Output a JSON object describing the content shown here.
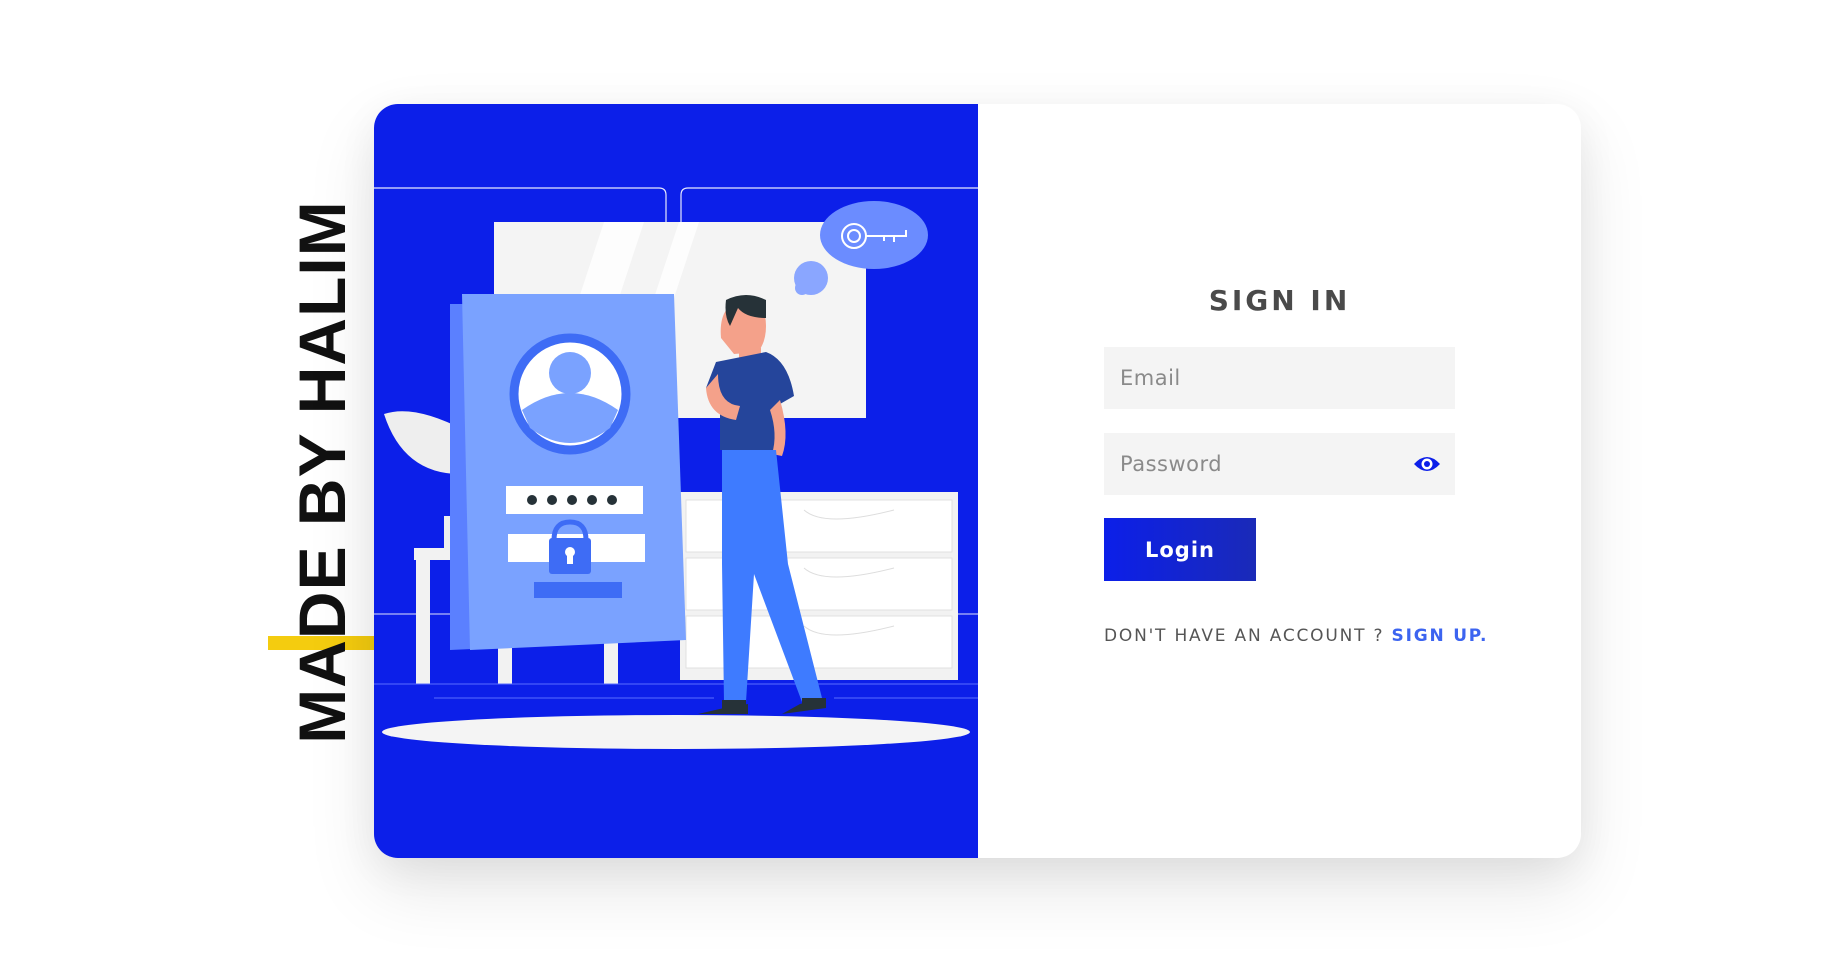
{
  "colors": {
    "brand_blue": "#0c1fe9",
    "accent_blue": "#3c64f0",
    "credit_bar": "#f4cc0f",
    "field_bg": "#f4f4f4"
  },
  "credit": {
    "text": "MADE BY HALIM"
  },
  "illustration": {
    "icon": "login-illustration"
  },
  "form": {
    "title": "SIGN IN",
    "email_placeholder": "Email",
    "password_placeholder": "Password",
    "password_toggle_icon": "eye-icon",
    "login_label": "Login",
    "signup_prompt": "DON'T HAVE AN ACCOUNT ? ",
    "signup_link": "SIGN UP",
    "signup_suffix": "."
  }
}
